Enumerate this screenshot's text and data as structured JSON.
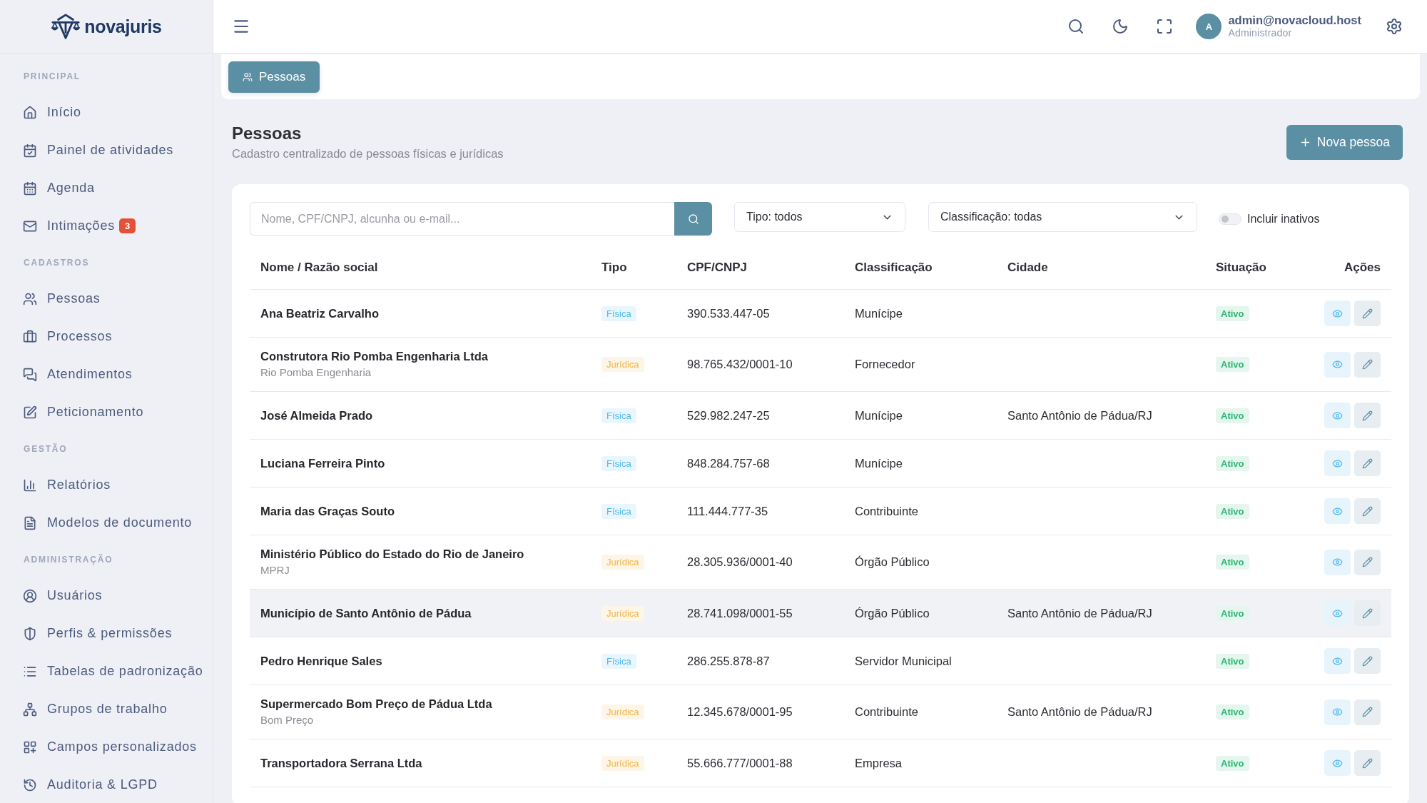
{
  "brand": {
    "name": "novajuris"
  },
  "topbar": {
    "user": {
      "initial": "A",
      "email": "admin@novacloud.host",
      "role": "Administrador"
    }
  },
  "sidebar": {
    "sections": [
      {
        "title": "PRINCIPAL",
        "items": [
          {
            "label": "Início"
          },
          {
            "label": "Painel de atividades"
          },
          {
            "label": "Agenda"
          },
          {
            "label": "Intimações",
            "badge": "3"
          }
        ]
      },
      {
        "title": "CADASTROS",
        "items": [
          {
            "label": "Pessoas"
          },
          {
            "label": "Processos"
          },
          {
            "label": "Atendimentos"
          },
          {
            "label": "Peticionamento"
          }
        ]
      },
      {
        "title": "GESTÃO",
        "items": [
          {
            "label": "Relatórios"
          },
          {
            "label": "Modelos de documento"
          }
        ]
      },
      {
        "title": "ADMINISTRAÇÃO",
        "items": [
          {
            "label": "Usuários"
          },
          {
            "label": "Perfis & permissões"
          },
          {
            "label": "Tabelas de padronização"
          },
          {
            "label": "Grupos de trabalho"
          },
          {
            "label": "Campos personalizados"
          },
          {
            "label": "Auditoria & LGPD"
          }
        ]
      }
    ]
  },
  "breadcrumb": [
    {
      "label": "Pessoas",
      "selected": true
    }
  ],
  "page_header": {
    "title": "Pessoas",
    "subtitle": "Cadastro centralizado de pessoas físicas e jurídicas",
    "action": "Nova pessoa"
  },
  "filters": {
    "search": {
      "placeholder": "Nome, CPF/CNPJ, alcunha ou e-mail..."
    },
    "selects": [
      {
        "value": "Tipo: todos"
      },
      {
        "value": "Classificação: todas"
      }
    ],
    "toggle": {
      "label": "Incluir inativos",
      "on": false
    }
  },
  "table": {
    "columns": [
      "Nome / Razão social",
      "Tipo",
      "CPF/CNPJ",
      "Classificação",
      "Cidade",
      "Situação",
      "Ações"
    ],
    "rows": [
      {
        "name": "Ana Beatriz Carvalho",
        "type": {
          "label": "Física",
          "color": "#4cb8ec"
        },
        "document": "390.533.447-05",
        "classification": "Munícipe",
        "status": "Ativo",
        "selected": false
      },
      {
        "name": "Construtora Rio Pomba Engenharia Ltda",
        "alias": "Rio Pomba Engenharia",
        "type": {
          "label": "Jurídica",
          "color": "#f2b443"
        },
        "document": "98.765.432/0001-10",
        "classification": "Fornecedor",
        "status": "Ativo",
        "selected": false
      },
      {
        "name": "José Almeida Prado",
        "type": {
          "label": "Física",
          "color": "#4cb8ec"
        },
        "document": "529.982.247-25",
        "classification": "Munícipe",
        "city": "Santo Antônio de Pádua/RJ",
        "status": "Ativo",
        "selected": false
      },
      {
        "name": "Luciana Ferreira Pinto",
        "type": {
          "label": "Física",
          "color": "#4cb8ec"
        },
        "document": "848.284.757-68",
        "classification": "Munícipe",
        "status": "Ativo",
        "selected": false
      },
      {
        "name": "Maria das Graças Souto",
        "type": {
          "label": "Física",
          "color": "#4cb8ec"
        },
        "document": "111.444.777-35",
        "classification": "Contribuinte",
        "status": "Ativo",
        "selected": false
      },
      {
        "name": "Ministério Público do Estado do Rio de Janeiro",
        "alias": "MPRJ",
        "type": {
          "label": "Jurídica",
          "color": "#f2b443"
        },
        "document": "28.305.936/0001-40",
        "classification": "Órgão Público",
        "status": "Ativo",
        "selected": false
      },
      {
        "name": "Município de Santo Antônio de Pádua",
        "type": {
          "label": "Jurídica",
          "color": "#f2b443"
        },
        "document": "28.741.098/0001-55",
        "classification": "Órgão Público",
        "city": "Santo Antônio de Pádua/RJ",
        "status": "Ativo",
        "selected": true
      },
      {
        "name": "Pedro Henrique Sales",
        "type": {
          "label": "Física",
          "color": "#4cb8ec"
        },
        "document": "286.255.878-87",
        "classification": "Servidor Municipal",
        "status": "Ativo",
        "selected": false
      },
      {
        "name": "Supermercado Bom Preço de Pádua Ltda",
        "alias": "Bom Preço",
        "type": {
          "label": "Jurídica",
          "color": "#f2b443"
        },
        "document": "12.345.678/0001-95",
        "classification": "Contribuinte",
        "city": "Santo Antônio de Pádua/RJ",
        "status": "Ativo",
        "selected": false
      },
      {
        "name": "Transportadora Serrana Ltda",
        "type": {
          "label": "Jurídica",
          "color": "#f2b443"
        },
        "document": "55.666.777/0001-88",
        "classification": "Empresa",
        "status": "Ativo",
        "selected": false
      }
    ]
  }
}
